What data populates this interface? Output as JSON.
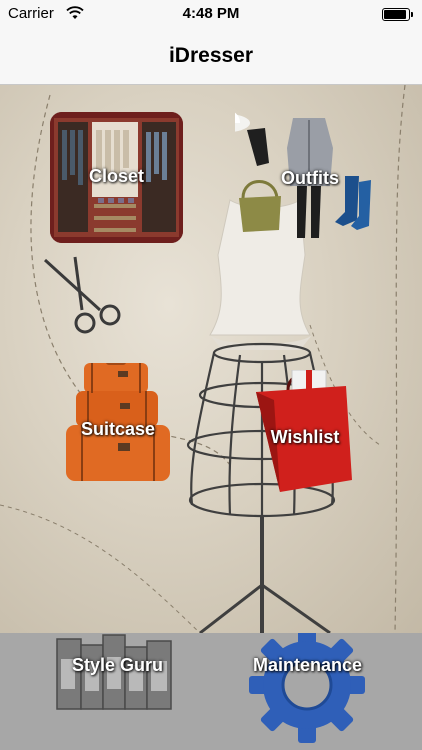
{
  "status_bar": {
    "carrier": "Carrier",
    "time": "4:48 PM"
  },
  "nav": {
    "title": "iDresser"
  },
  "menu": {
    "closet": "Closet",
    "outfits": "Outfits",
    "suitcase": "Suitcase",
    "wishlist": "Wishlist",
    "style_guru": "Style Guru",
    "maintenance": "Maintenance"
  },
  "icons": {
    "wifi": "wifi-icon",
    "battery": "battery-icon",
    "closet": "wardrobe-icon",
    "outfits": "clothing-icon",
    "suitcase": "luggage-icon",
    "wishlist": "shopping-bag-icon",
    "style_guru": "letterpress-icon",
    "maintenance": "gear-icon"
  },
  "colors": {
    "bar_bg": "#f7f7f7",
    "bottom_bar": "#a7a7a7",
    "gear_blue": "#2f5fb8",
    "bag_red": "#d0201c",
    "luggage_orange": "#e06a23"
  }
}
